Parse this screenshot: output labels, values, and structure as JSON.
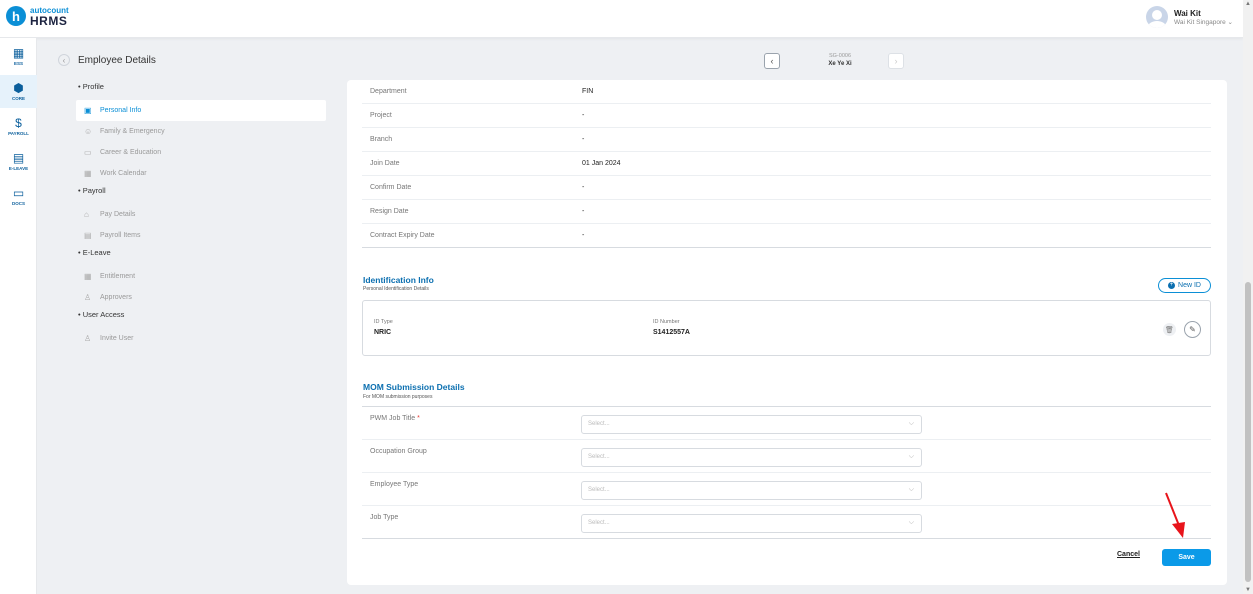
{
  "app": {
    "logo_top": "autocount",
    "logo_bottom": "HRMS",
    "logo_letter": "h"
  },
  "user": {
    "name": "Wai Kit",
    "company": "Wai Kit Singapore ⌄"
  },
  "nav": [
    {
      "label": "ESS",
      "icon": "ess-icon"
    },
    {
      "label": "CORE",
      "icon": "core-icon"
    },
    {
      "label": "PAYROLL",
      "icon": "payroll-icon"
    },
    {
      "label": "E-LEAVE",
      "icon": "eleave-icon"
    },
    {
      "label": "DOCS",
      "icon": "docs-icon"
    }
  ],
  "header": {
    "title": "Employee Details",
    "emp_code": "SG-0006",
    "emp_name": "Xe Ye Xi"
  },
  "sidebar": {
    "groups": [
      {
        "label": "Profile",
        "items": [
          "Personal Info",
          "Family & Emergency",
          "Career & Education",
          "Work Calendar"
        ]
      },
      {
        "label": "Payroll",
        "items": [
          "Pay Details",
          "Payroll Items"
        ]
      },
      {
        "label": "E-Leave",
        "items": [
          "Entitlement",
          "Approvers"
        ]
      },
      {
        "label": "User Access",
        "items": [
          "Invite User"
        ]
      }
    ]
  },
  "details": [
    {
      "label": "Department",
      "value": "FIN"
    },
    {
      "label": "Project",
      "value": "-"
    },
    {
      "label": "Branch",
      "value": "-"
    },
    {
      "label": "Join Date",
      "value": "01 Jan 2024"
    },
    {
      "label": "Confirm Date",
      "value": "-"
    },
    {
      "label": "Resign Date",
      "value": "-"
    },
    {
      "label": "Contract Expiry Date",
      "value": "-"
    }
  ],
  "identification": {
    "title": "Identification Info",
    "subtitle": "Personal Identification Details",
    "new_button": "New ID",
    "id_type_label": "ID Type",
    "id_type_value": "NRIC",
    "id_number_label": "ID Number",
    "id_number_value": "S1412557A"
  },
  "mom": {
    "title": "MOM Submission Details",
    "subtitle": "For MOM submission purposes",
    "fields": [
      {
        "label": "PWM Job Title",
        "required": "*",
        "placeholder": "Select..."
      },
      {
        "label": "Occupation Group",
        "required": "",
        "placeholder": "Select..."
      },
      {
        "label": "Employee Type",
        "required": "",
        "placeholder": "Select..."
      },
      {
        "label": "Job Type",
        "required": "",
        "placeholder": "Select..."
      }
    ]
  },
  "actions": {
    "cancel": "Cancel",
    "save": "Save"
  },
  "colors": {
    "accent": "#0b8fd6",
    "save": "#0b9ae8",
    "arrow": "#e8141b"
  }
}
